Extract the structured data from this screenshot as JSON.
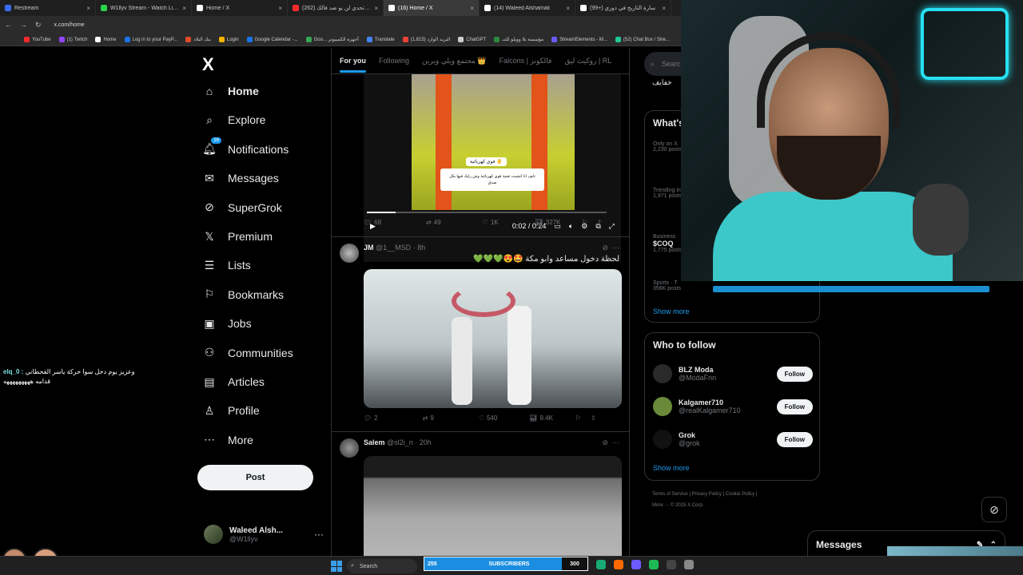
{
  "browser": {
    "tabs": [
      {
        "title": "Restream",
        "color": "#3b6cff"
      },
      {
        "title": "W1llyv Stream - Watch Live on",
        "color": "#2bd24b"
      },
      {
        "title": "Home / X",
        "color": "#ffffff"
      },
      {
        "title": "(262) طارق تحدي لن يو ضد فالك",
        "color": "#ff2a2a"
      },
      {
        "title": "(16) Home / X",
        "color": "#ffffff"
      },
      {
        "title": "(14) Waleed Alshamali",
        "color": "#ffffff"
      },
      {
        "title": "(99+) سارة التاريخ في دوري",
        "color": "#ffffff"
      }
    ],
    "url": "x.com/home",
    "bookmarks": [
      {
        "label": "YouTube",
        "color": "#ff2a2a"
      },
      {
        "label": "(1) Twitch",
        "color": "#9146ff"
      },
      {
        "label": "Home",
        "color": "#ffffff"
      },
      {
        "label": "Log in to your PayP...",
        "color": "#1a73e8"
      },
      {
        "label": "بنك البلاد",
        "color": "#e24a2a"
      },
      {
        "label": "Login",
        "color": "#f5b400"
      },
      {
        "label": "Google Calendar -...",
        "color": "#1a73e8"
      },
      {
        "label": "Goo... أجهزة الكمبيوتر",
        "color": "#34a853"
      },
      {
        "label": "Translate",
        "color": "#4285f4"
      },
      {
        "label": "(1,815) البريد الوارد",
        "color": "#ea4335"
      },
      {
        "label": "ChatGPT",
        "color": "#cccccc"
      },
      {
        "label": "مؤسسة بلا وويلو للتنـ",
        "color": "#2b8a3e"
      },
      {
        "label": "StreamElements - M...",
        "color": "#6b5bff"
      },
      {
        "label": "(52) Chat Box / Stre...",
        "color": "#20c997"
      }
    ]
  },
  "nav": {
    "logo": "X",
    "items": [
      {
        "label": "Home",
        "icon": "home-icon",
        "glyph": "⌂",
        "bold": true
      },
      {
        "label": "Explore",
        "icon": "search-icon",
        "glyph": "⌕"
      },
      {
        "label": "Notifications",
        "icon": "bell-icon",
        "glyph": "🔔︎",
        "badge": "16"
      },
      {
        "label": "Messages",
        "icon": "envelope-icon",
        "glyph": "✉"
      },
      {
        "label": "SuperGrok",
        "icon": "grok-icon",
        "glyph": "⊘"
      },
      {
        "label": "Premium",
        "icon": "x-premium-icon",
        "glyph": "𝕏"
      },
      {
        "label": "Lists",
        "icon": "list-icon",
        "glyph": "☰"
      },
      {
        "label": "Bookmarks",
        "icon": "bookmark-icon",
        "glyph": "⚐"
      },
      {
        "label": "Jobs",
        "icon": "briefcase-icon",
        "glyph": "▣"
      },
      {
        "label": "Communities",
        "icon": "people-icon",
        "glyph": "⚇"
      },
      {
        "label": "Articles",
        "icon": "article-icon",
        "glyph": "▤"
      },
      {
        "label": "Profile",
        "icon": "person-icon",
        "glyph": "♙"
      },
      {
        "label": "More",
        "icon": "more-circle-icon",
        "glyph": "⋯"
      }
    ],
    "post_label": "Post",
    "account": {
      "name": "Waleed Alsh...",
      "handle": "@W1llyv"
    }
  },
  "chat_overlay": {
    "user": "elq_0 :",
    "message": "وعزيز يوم دخل سوا حركة ياسر القحطاني",
    "message2": "قدامه هههههههههه"
  },
  "feed": {
    "tabs": [
      "For you",
      "Following",
      "مجتمع ويلي وبرين 👑",
      "Falcons | فالكونز",
      "روكيت ليق | RL"
    ],
    "video1": {
      "caption_top": "فوي كهربائية 🤚",
      "caption_main": "تايف انا انشبت تعنية فوي كهربائية وش رايك فيها بكل صدق",
      "time": "0:02 / 0:24"
    },
    "post1_actions": {
      "replies": "68",
      "reposts": "49",
      "likes": "1K",
      "views": "327K"
    },
    "post2": {
      "name": "JM",
      "handle": "@1__MSD",
      "time": "8h",
      "text": "لحظة دخول مساعد وابو مكة 🤩😍💚💚💚",
      "actions": {
        "replies": "2",
        "reposts": "9",
        "likes": "540",
        "views": "9.4K"
      }
    },
    "post3": {
      "name": "Salem",
      "handle": "@sl2i_n",
      "time": "20h"
    }
  },
  "right": {
    "search_placeholder": "Search",
    "pill": "خفايف",
    "whats_happening": "What's happening",
    "trends": [
      {
        "meta": "Only on X",
        "title": "",
        "posts": "2,230 posts"
      },
      {
        "meta": "Trending in",
        "title": "",
        "posts": "1,971 posts"
      },
      {
        "meta": "Business",
        "title": "$COQ",
        "posts": "1,775 posts"
      },
      {
        "meta": "Sports · T",
        "title": "",
        "posts": "356K posts"
      }
    ],
    "show_more": "Show more",
    "who_to_follow": "Who to follow",
    "suggestions": [
      {
        "name": "BLZ Moda",
        "handle": "@ModaFnn",
        "color": "#2a2a2a"
      },
      {
        "name": "Kalgamer710",
        "handle": "@realKalgamer710",
        "color": "#6a8a3a"
      },
      {
        "name": "Grok",
        "handle": "@grok",
        "color": "#111111"
      }
    ],
    "follow_label": "Follow",
    "footer1": "Terms of Service  |  Privacy Policy  |  Cookie Policy  |",
    "footer2": "More ···  © 2025 X Corp."
  },
  "messages_drawer": "Messages",
  "taskbar": {
    "search": "Search",
    "subs_left": "255",
    "subs_center": "SUBSCRIBERS",
    "subs_right": "300"
  }
}
